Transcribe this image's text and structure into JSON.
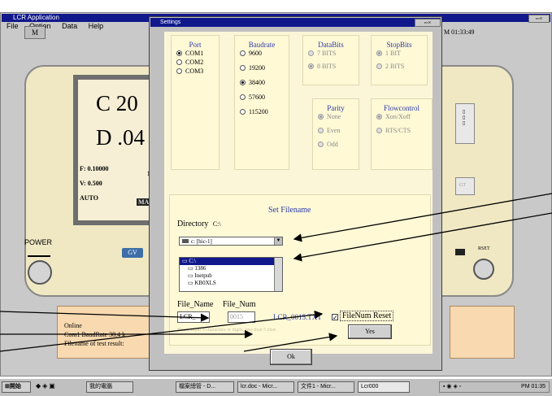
{
  "app": {
    "title": "LCR Application",
    "menu": [
      "File",
      "Option",
      "Data",
      "Help"
    ],
    "small_button": "M",
    "clock_fragment": "M 01:33:49",
    "lcd": {
      "line1": "C  20",
      "line2": "D  .04",
      "freq": "F: 0.10000",
      "freq_extra": "1",
      "volt": "V: 0.500",
      "mode": "AUTO",
      "mode_badge": "MA"
    },
    "power_label": "POWER",
    "gv_badge": "GV",
    "side_label": "RSET",
    "status": {
      "line1": "Online",
      "line2": "Com1 BaudRate 38.4 k",
      "line3": "Filename of test result:"
    }
  },
  "dialog": {
    "title": "Settings",
    "port": {
      "header": "Port",
      "options": [
        "COM1",
        "COM2",
        "COM3"
      ],
      "selected": "COM1"
    },
    "baudrate": {
      "header": "Baudrate",
      "options": [
        "9600",
        "19200",
        "38400",
        "57600",
        "115200"
      ],
      "selected": "38400"
    },
    "databits": {
      "header": "DataBits",
      "options": [
        "7 BITS",
        "8 BITS"
      ],
      "selected": "8 BITS"
    },
    "stopbits": {
      "header": "StopBits",
      "options": [
        "1 BIT",
        "2 BITS"
      ],
      "selected": "1 BIT"
    },
    "parity": {
      "header": "Parity",
      "options": [
        "None",
        "Even",
        "Odd"
      ],
      "selected": "None"
    },
    "flowcontrol": {
      "header": "Flowcontrol",
      "options": [
        "Xon/Xoff",
        "RTS/CTS"
      ],
      "selected": "Xon/Xoff"
    },
    "set_filename": {
      "header": "Set Filename",
      "directory_label": "Directory",
      "directory_value": "C:\\",
      "drive_combo": "c: [hic-1]",
      "folders": [
        "C:\\",
        "1386",
        "Inetpub",
        "KB0XLS"
      ],
      "file_name_label": "File_Name",
      "file_num_label": "File_Num",
      "file_name_value": "LCR_",
      "file_num_value": "0015",
      "preview": "LCR_0015.TXT",
      "hint": "Please input 4 characters or digits, less than 5 char.",
      "filenum_reset_label": "FileNum Reset",
      "filenum_reset_checked": true,
      "yes_button": "Yes"
    },
    "ok_button": "Ok"
  },
  "taskbar": {
    "start": "開始",
    "tasks": [
      "我的電腦",
      "檔案總管 - D...",
      "lcr.doc - Micr...",
      "文件1 - Micr...",
      "Lcr000"
    ],
    "clock": "PM 01:35"
  }
}
